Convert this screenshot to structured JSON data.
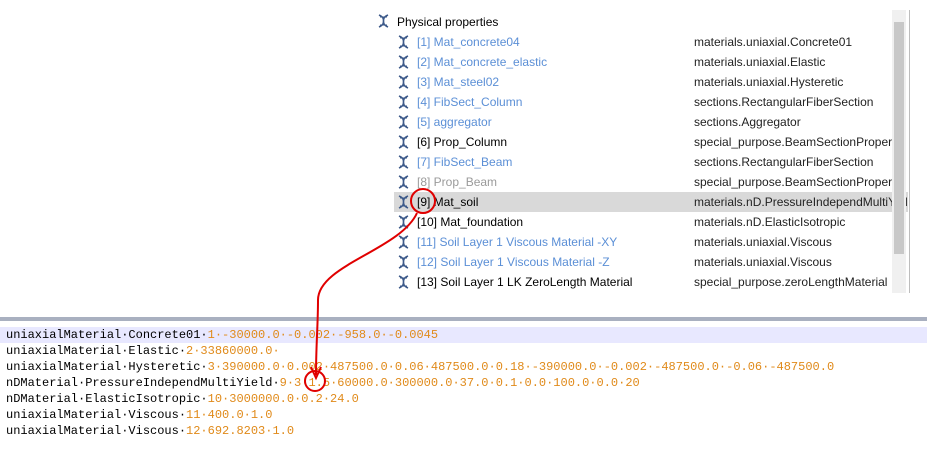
{
  "tree": {
    "header": "Physical properties",
    "rows": [
      {
        "name": "[1] Mat_concrete04",
        "type": "materials.uniaxial.Concrete01"
      },
      {
        "name": "[2] Mat_concrete_elastic",
        "type": "materials.uniaxial.Elastic"
      },
      {
        "name": "[3] Mat_steel02",
        "type": "materials.uniaxial.Hysteretic"
      },
      {
        "name": "[4] FibSect_Column",
        "type": "sections.RectangularFiberSection"
      },
      {
        "name": "[5] aggregator",
        "type": "sections.Aggregator"
      },
      {
        "name": "[6] Prop_Column",
        "type": "special_purpose.BeamSectionProperty"
      },
      {
        "name": "[7] FibSect_Beam",
        "type": "sections.RectangularFiberSection"
      },
      {
        "name": "[8] Prop_Beam",
        "type": "special_purpose.BeamSectionProperty"
      },
      {
        "name": "[9] Mat_soil",
        "type": "materials.nD.PressureIndependMultiYield"
      },
      {
        "name": "[10] Mat_foundation",
        "type": "materials.nD.ElasticIsotropic"
      },
      {
        "name": "[11] Soil Layer 1 Viscous Material -XY",
        "type": "materials.uniaxial.Viscous"
      },
      {
        "name": "[12] Soil Layer 1 Viscous Material -Z",
        "type": "materials.uniaxial.Viscous"
      },
      {
        "name": "[13] Soil Layer 1 LK ZeroLength Material",
        "type": "special_purpose.zeroLengthMaterial"
      }
    ]
  },
  "code": {
    "lines": [
      {
        "kw": "uniaxialMaterial·Concrete01·",
        "args": "1·-30000.0·-0.002·-958.0·-0.0045"
      },
      {
        "kw": "uniaxialMaterial·Elastic·",
        "args": "2·33860000.0·"
      },
      {
        "kw": "uniaxialMaterial·Hysteretic·",
        "args": "3·390000.0·0.002·487500.0·0.06·487500.0·0.18·-390000.0·-0.002·-487500.0·-0.06·-487500.0"
      },
      {
        "kw": "nDMaterial·PressureIndependMultiYield·",
        "args": "9·3·1.5·60000.0·300000.0·37.0·0.1·0.0·100.0·0.0·20"
      },
      {
        "kw": "nDMaterial·ElasticIsotropic·",
        "args": "10·3000000.0·0.2·24.0"
      },
      {
        "kw": "uniaxialMaterial·Viscous·",
        "args": "11·400.0·1.0"
      },
      {
        "kw": "uniaxialMaterial·Viscous·",
        "args": "12·692.8203·1.0"
      }
    ]
  },
  "colors": {
    "ref_link": "#5b8fd6",
    "annotation": "#e00000",
    "number": "#e08a1a",
    "selected_row": "#d9d9d9"
  }
}
